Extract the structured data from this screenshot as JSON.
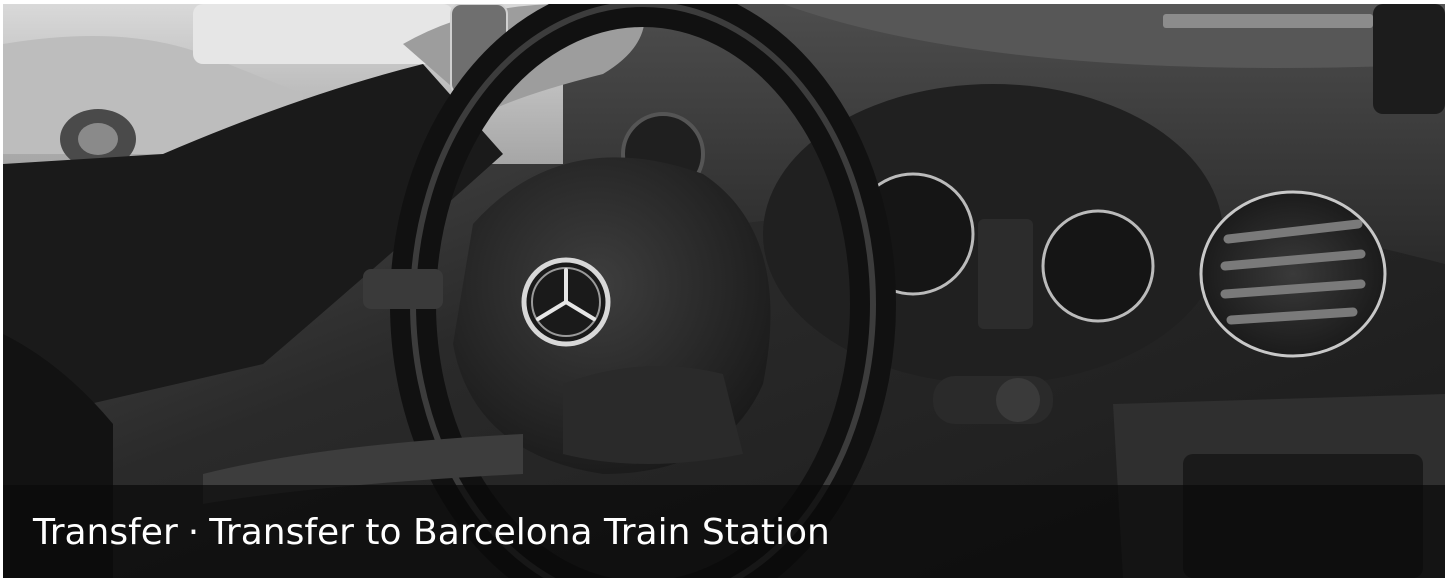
{
  "banner": {
    "image_alt": "Driver's hand on the steering wheel of a Mercedes car, black and white photo",
    "category": "Transfer",
    "separator": "·",
    "title": "Transfer to Barcelona Train Station"
  },
  "colors": {
    "caption_bar": "#0a0a0a",
    "caption_text": "#ffffff"
  }
}
